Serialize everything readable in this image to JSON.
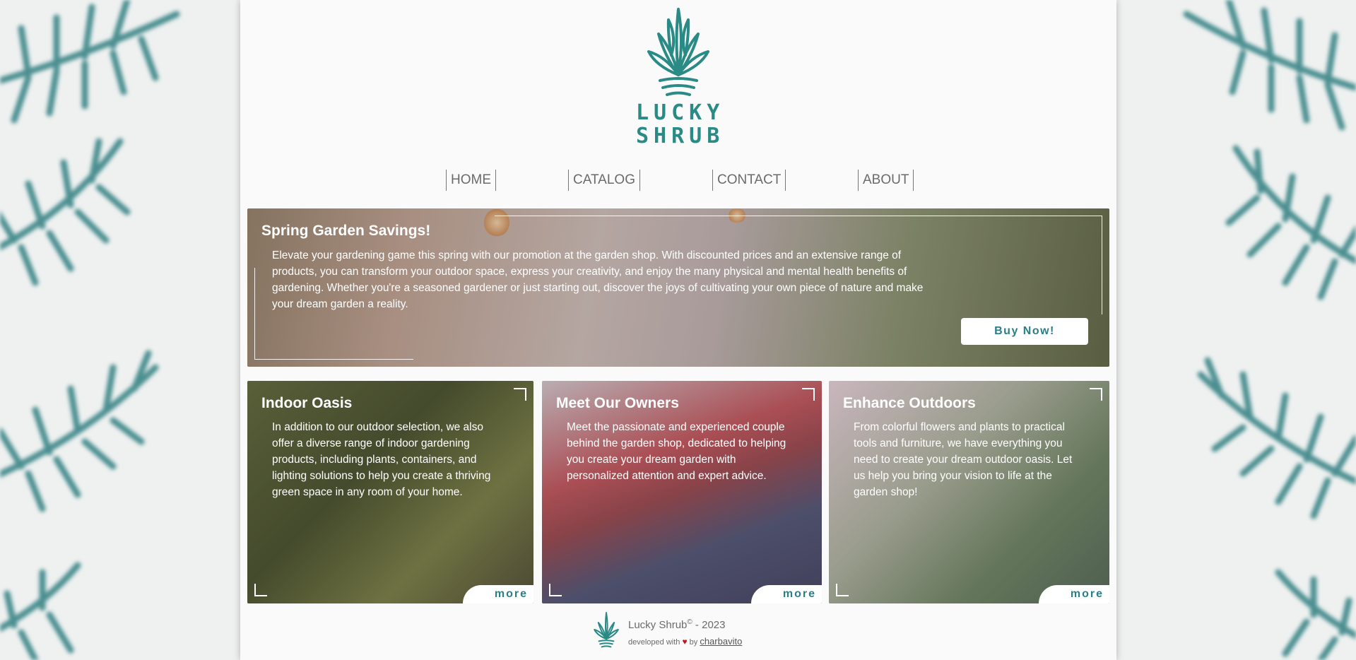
{
  "brand": {
    "line1": "LUCKY",
    "line2": "SHRUB",
    "accent": "#2a8a85"
  },
  "nav": [
    {
      "label": "HOME"
    },
    {
      "label": "CATALOG"
    },
    {
      "label": "CONTACT"
    },
    {
      "label": "ABOUT"
    }
  ],
  "hero": {
    "title": "Spring Garden Savings!",
    "text": "Elevate your gardening game this spring with our promotion at the garden shop. With discounted prices and an extensive range of products, you can transform your outdoor space, express your creativity, and enjoy the many physical and mental health benefits of gardening. Whether you're a seasoned gardener or just starting out, discover the joys of cultivating your own piece of nature and make your dream garden a reality.",
    "button": "Buy Now!"
  },
  "cards": [
    {
      "title": "Indoor Oasis",
      "text": "In addition to our outdoor selection, we also offer a diverse range of indoor gardening products, including plants, containers, and lighting solutions to help you create a thriving green space in any room of your home.",
      "more": "more"
    },
    {
      "title": "Meet Our Owners",
      "text": "Meet the passionate and experienced couple behind the garden shop, dedicated to helping you create your dream garden with personalized attention and expert advice.",
      "more": "more"
    },
    {
      "title": "Enhance Outdoors",
      "text": "From colorful flowers and plants to practical tools and furniture, we have everything you need to create your dream outdoor oasis. Let us help you bring your vision to life at the garden shop!",
      "more": "more"
    }
  ],
  "footer": {
    "name": "Lucky Shrub",
    "copyright": "©",
    "year": " - 2023",
    "developed_with": "developed with",
    "heart": "♥",
    "by": "by",
    "author": "charbavito"
  },
  "icons": [
    "leaf-plant-logo-icon",
    "heart-icon",
    "fern-decoration-icon"
  ]
}
